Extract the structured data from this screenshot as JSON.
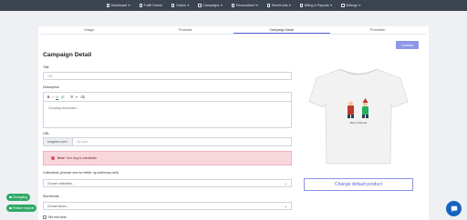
{
  "nav": [
    {
      "label": "Dashboard",
      "icon": "dashboard-icon"
    },
    {
      "label": "Fulfill Orders",
      "icon": "box-icon"
    },
    {
      "label": "Orders",
      "icon": "cart-icon"
    },
    {
      "label": "Campaigns",
      "icon": "megaphone-icon"
    },
    {
      "label": "Personalized",
      "icon": "user-icon"
    },
    {
      "label": "Storefronts",
      "icon": "store-icon"
    },
    {
      "label": "Billing & Payouts",
      "icon": "wallet-icon"
    },
    {
      "label": "Settings",
      "icon": "gear-icon"
    }
  ],
  "tabs": [
    "Design",
    "Products",
    "Campaign Detail",
    "Promotion"
  ],
  "active_tab": "Campaign Detail",
  "continue_label": "Continue",
  "page_title": "Campaign Detail",
  "title_field": {
    "label": "Title",
    "placeholder": "Title"
  },
  "description": {
    "label": "Description",
    "placeholder": "Campaign description..."
  },
  "toolbar": {
    "bold": "B",
    "italic": "I",
    "underline": "U",
    "link": "🔗",
    "list_ul": "☰",
    "list_ol": "≡",
    "clear": "⌫"
  },
  "url": {
    "label": "URL",
    "prefix": "songtomu.com/",
    "placeholder": "my-store"
  },
  "error": {
    "prefix": "Error:",
    "message": "Your slug is unavailable."
  },
  "collections": {
    "label": "Collections (choose one for better up-sell/cross-sell)",
    "placeholder": "Choose collections..."
  },
  "storefronts": {
    "label": "Storefronts",
    "placeholder": "Choose stores..."
  },
  "set_end_time": "Set end time",
  "default_product_button": "Change default product",
  "product_image": {
    "caption": "Merry christmas",
    "shirt_color": "#f2f2f2"
  },
  "pills": [
    {
      "label": "Changelog",
      "icon": "clock-icon"
    },
    {
      "label": "Feature request",
      "icon": "plus-icon"
    }
  ],
  "colors": {
    "accent": "#5a67d8",
    "nav_bg": "#3b4350",
    "pill_green": "#2ea968",
    "chat_blue": "#1565c0",
    "error_bg": "#f8d7dc"
  }
}
